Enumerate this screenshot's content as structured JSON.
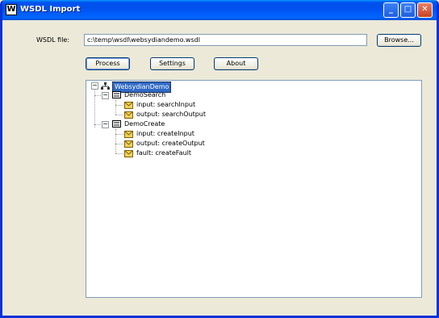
{
  "window": {
    "title": "WSDL Import",
    "minimize": "_",
    "maximize": "□",
    "close": "✕",
    "app_icon": "W"
  },
  "form": {
    "wsdl_label": "WSDL file:",
    "wsdl_value": "c:\\temp\\wsdl\\websydiandemo.wsdl",
    "browse_label": "Browse...",
    "process_label": "Process",
    "settings_label": "Settings",
    "about_label": "About"
  },
  "tree": {
    "root": {
      "label": "WebsydianDemo",
      "expander": "−"
    },
    "services": [
      {
        "label": "DemoSearch",
        "expander": "−",
        "children": [
          "input: searchInput",
          "output: searchOutput"
        ]
      },
      {
        "label": "DemoCreate",
        "expander": "−",
        "children": [
          "input: createInput",
          "output: createOutput",
          "fault: createFault"
        ]
      }
    ]
  },
  "colors": {
    "titlebar": "#0053ee",
    "selection": "#316ac5",
    "window_bg": "#ece9d8"
  }
}
